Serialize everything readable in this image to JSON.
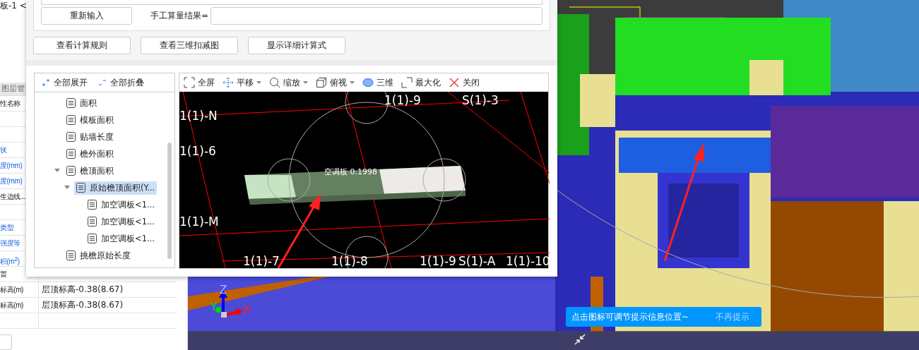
{
  "left_panel": {
    "title_fragment": "板-1 <",
    "tab": "图层管",
    "rows": [
      {
        "kind": "plain",
        "label": "性名称"
      },
      {
        "kind": "empty"
      },
      {
        "kind": "empty"
      },
      {
        "kind": "link",
        "label": "状"
      },
      {
        "kind": "link",
        "label": "度(mm)"
      },
      {
        "kind": "link",
        "label": "度(mm)"
      },
      {
        "kind": "plain",
        "label": "生边线..."
      },
      {
        "kind": "empty"
      },
      {
        "kind": "link",
        "label": "类型"
      },
      {
        "kind": "link",
        "label": "强度等"
      },
      {
        "kind": "link",
        "label": "积(m$^{2}$)"
      },
      {
        "kind": "plain",
        "label": "置"
      },
      {
        "kind": "plain",
        "label": "标高(m)",
        "value": "层顶标高-0.38(8.67)"
      },
      {
        "kind": "plain",
        "label": "标高(m)",
        "value": "层顶标高-0.38(8.67)"
      },
      {
        "kind": "empty"
      }
    ]
  },
  "dialog": {
    "reset_button": "重新输入",
    "result_label": "手工算量结果=",
    "buttons": [
      "查看计算规则",
      "查看三维扣减图",
      "显示详细计算式"
    ],
    "tree_actions": [
      {
        "kind": "expand",
        "label": "全部展开"
      },
      {
        "kind": "collapse",
        "label": "全部折叠"
      }
    ],
    "tree": [
      {
        "label": "面积",
        "selected": false
      },
      {
        "label": "模板面积",
        "selected": false
      },
      {
        "label": "贴墙长度",
        "selected": false
      },
      {
        "label": "檐外面积",
        "selected": false
      },
      {
        "label": "檐顶面积",
        "selected": false,
        "expanded": true,
        "children": [
          {
            "label": "原始檐顶面积(Y...",
            "selected": true,
            "expanded": true,
            "children": [
              {
                "label": "加空调板<1...",
                "selected": false
              },
              {
                "label": "加空调板<1...",
                "selected": false
              },
              {
                "label": "加空调板<1...",
                "selected": false
              }
            ]
          }
        ]
      },
      {
        "label": "挑檐原始长度",
        "selected": false
      }
    ],
    "viewer": {
      "tools": [
        {
          "kind": "fullscreen",
          "label": "全屏",
          "dropdown": false
        },
        {
          "kind": "pan",
          "label": "平移",
          "dropdown": true
        },
        {
          "kind": "zoom",
          "label": "缩放",
          "dropdown": true
        },
        {
          "kind": "topview",
          "label": "俯视",
          "dropdown": true
        },
        {
          "kind": "threed",
          "label": "三维",
          "dropdown": false
        },
        {
          "kind": "maximize",
          "label": "最大化",
          "dropdown": false
        },
        {
          "kind": "close",
          "label": "关闭",
          "dropdown": false
        }
      ],
      "grid_labels": [
        "1(1)-9",
        "S(1)-3",
        "1(1)-N",
        "1(1)-6",
        "1(1)-M",
        "1(1)-7",
        "1(1)-8",
        "1(1)-9",
        "S(1)-A",
        "1(1)-10"
      ],
      "slab_label": "空调板 0.1998"
    }
  },
  "scene": {
    "axes": [
      "X",
      "Y",
      "Z"
    ],
    "tooltip": {
      "text": "点击图标可调节提示信息位置~",
      "dismiss": "不再提示"
    }
  }
}
